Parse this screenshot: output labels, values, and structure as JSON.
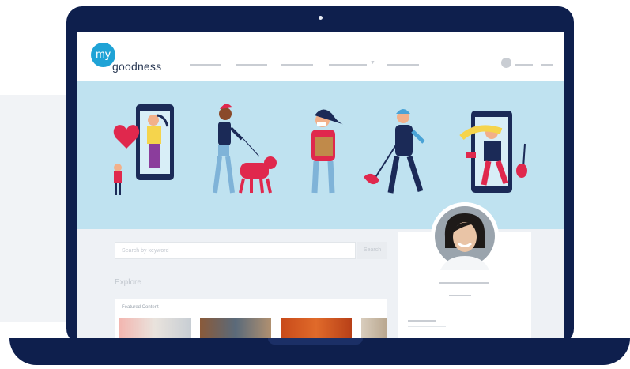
{
  "logo": {
    "badge": "my",
    "word": "goodness"
  },
  "search": {
    "placeholder": "Search by keyword",
    "button": "Search"
  },
  "explore_heading": "Explore",
  "featured_label": "Featured Content",
  "colors": {
    "frame": "#0e1f4d",
    "hero": "#bfe2f0",
    "brand": "#1fa3d6"
  }
}
